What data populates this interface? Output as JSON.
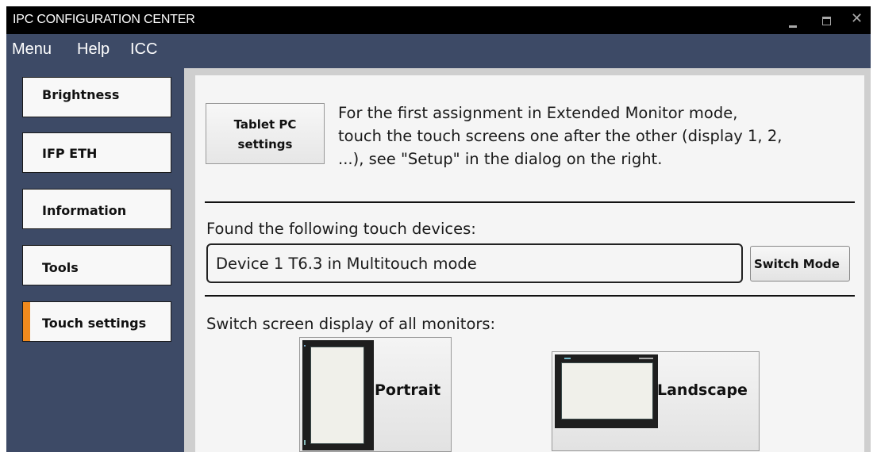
{
  "window": {
    "title": "IPC CONFIGURATION CENTER",
    "minimize_icon": "minimize-icon",
    "maximize_icon": "maximize-icon",
    "close_glyph": "✕"
  },
  "menubar": {
    "items": [
      "Menu",
      "Help",
      "ICC"
    ]
  },
  "sidebar": {
    "items": [
      {
        "label": "Brightness",
        "active": false
      },
      {
        "label": "IFP ETH",
        "active": false
      },
      {
        "label": "Information",
        "active": false
      },
      {
        "label": "Tools",
        "active": false
      },
      {
        "label": "Touch settings",
        "active": true
      }
    ]
  },
  "touch_settings": {
    "tablet_button": {
      "line1": "Tablet PC",
      "line2": "settings"
    },
    "instruction_lines": [
      "For the first assignment in Extended Monitor mode,",
      "touch the touch screens one after the other (display 1, 2,",
      "...), see \"Setup\" in the dialog on the right."
    ],
    "found_label": "Found the following touch devices:",
    "device_entry": "Device 1 T6.3  in  Multitouch mode",
    "switch_mode_label": "Switch Mode",
    "switch_display_label": "Switch screen display of all monitors:",
    "portrait_label": "Portrait",
    "landscape_label": "Landscape"
  },
  "colors": {
    "accent": "#f08a1e",
    "window_bg": "#3d4a66",
    "titlebar": "#000000"
  }
}
